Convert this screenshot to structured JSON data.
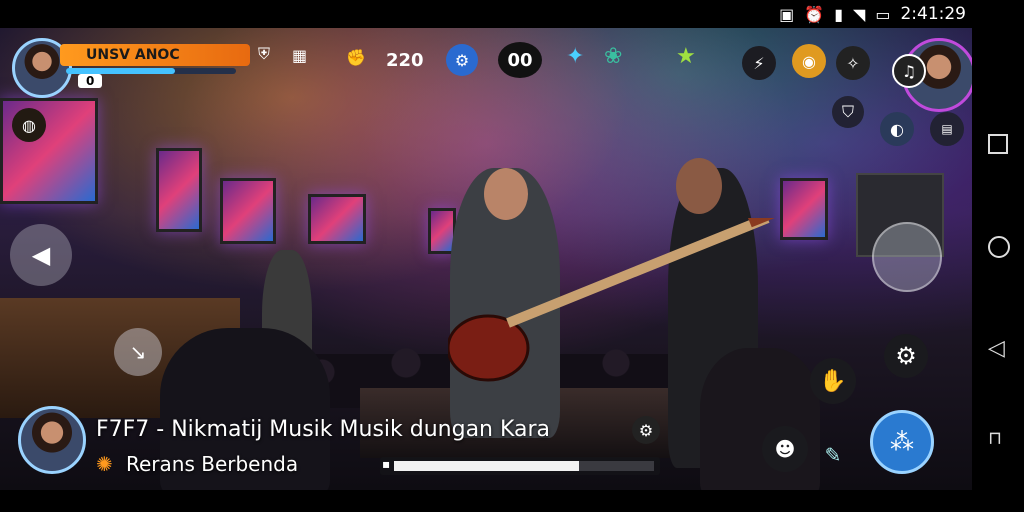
{
  "status_bar": {
    "time": "2:41:29",
    "icons": [
      "nfc-icon",
      "alarm-icon",
      "signal-icon",
      "wifi-icon",
      "battery-icon"
    ]
  },
  "hud": {
    "player_name": "UNSV ANOC",
    "player_level_badge": "0",
    "counter_1": "220",
    "counter_2": "00",
    "xp_progress": 0.64
  },
  "caption": {
    "title": "F7F7 - Nikmatij Musik Musik dungan Kara",
    "subtitle": "Rerans Berbenda",
    "playback_progress": 0.71
  },
  "nav": {
    "buttons": [
      "recent-apps",
      "home",
      "back"
    ]
  },
  "colors": {
    "accent_orange": "#ff9a1e",
    "accent_blue": "#45c2ff",
    "hud_ring": "#9ad3ff"
  }
}
